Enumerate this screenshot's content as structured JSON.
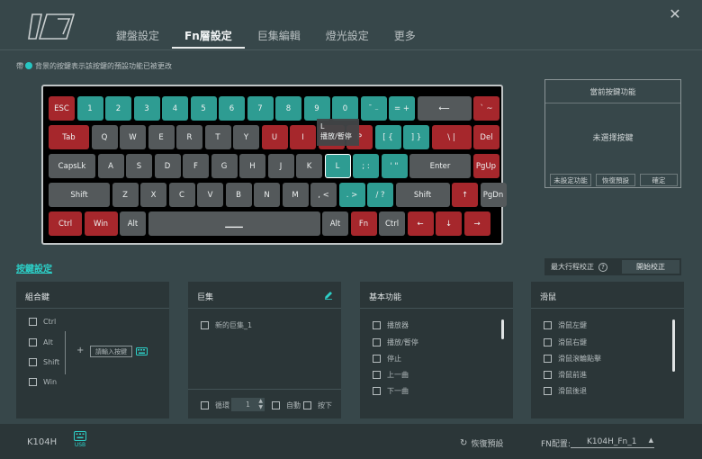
{
  "app": {
    "close_glyph": "✕"
  },
  "tabs": [
    {
      "label": "鍵盤設定"
    },
    {
      "label": "Fn層設定"
    },
    {
      "label": "巨集編輯"
    },
    {
      "label": "燈光設定"
    },
    {
      "label": "更多"
    }
  ],
  "legend": {
    "prefix": "帶",
    "text": "背景的按鍵表示該按鍵的預設功能已被更改",
    "color": "#26c6c2"
  },
  "keyboard": {
    "rows": [
      [
        {
          "label": "ESC",
          "c": "r",
          "w": 29
        },
        {
          "label": "1",
          "c": "t",
          "w": 29
        },
        {
          "label": "2",
          "c": "t",
          "w": 29
        },
        {
          "label": "3",
          "c": "t",
          "w": 29
        },
        {
          "label": "4",
          "c": "t",
          "w": 29
        },
        {
          "label": "5",
          "c": "t",
          "w": 29
        },
        {
          "label": "6",
          "c": "t",
          "w": 29
        },
        {
          "label": "7",
          "c": "t",
          "w": 29
        },
        {
          "label": "8",
          "c": "t",
          "w": 29
        },
        {
          "label": "9",
          "c": "t",
          "w": 29
        },
        {
          "label": "0",
          "c": "t",
          "w": 29
        },
        {
          "label": "¯ ₋",
          "c": "t",
          "w": 29
        },
        {
          "label": "= +",
          "c": "t",
          "w": 29
        },
        {
          "label": "⟵",
          "c": "g",
          "w": 60
        },
        {
          "label": "` ~",
          "c": "r",
          "w": 29
        }
      ],
      [
        {
          "label": "Tab",
          "c": "r",
          "w": 45
        },
        {
          "label": "Q",
          "c": "g",
          "w": 29
        },
        {
          "label": "W",
          "c": "g",
          "w": 29
        },
        {
          "label": "E",
          "c": "g",
          "w": 29
        },
        {
          "label": "R",
          "c": "g",
          "w": 29
        },
        {
          "label": "T",
          "c": "g",
          "w": 29
        },
        {
          "label": "Y",
          "c": "g",
          "w": 29
        },
        {
          "label": "U",
          "c": "r",
          "w": 29
        },
        {
          "label": "I",
          "c": "r",
          "w": 29
        },
        {
          "label": "O",
          "c": "r",
          "w": 29
        },
        {
          "label": "P",
          "c": "r",
          "w": 29
        },
        {
          "label": "[ {",
          "c": "t",
          "w": 29
        },
        {
          "label": "] }",
          "c": "t",
          "w": 29
        },
        {
          "label": "\\ |",
          "c": "r",
          "w": 44
        },
        {
          "label": "Del",
          "c": "r",
          "w": 29
        }
      ],
      [
        {
          "label": "CapsLk",
          "c": "g",
          "w": 52
        },
        {
          "label": "A",
          "c": "g",
          "w": 29
        },
        {
          "label": "S",
          "c": "g",
          "w": 29
        },
        {
          "label": "D",
          "c": "g",
          "w": 29
        },
        {
          "label": "F",
          "c": "g",
          "w": 29
        },
        {
          "label": "G",
          "c": "g",
          "w": 29
        },
        {
          "label": "H",
          "c": "g",
          "w": 29
        },
        {
          "label": "J",
          "c": "g",
          "w": 29
        },
        {
          "label": "K",
          "c": "g",
          "w": 29
        },
        {
          "label": "L",
          "c": "t",
          "w": 29,
          "sel": true
        },
        {
          "label": "; :",
          "c": "t",
          "w": 29
        },
        {
          "label": "' \"",
          "c": "t",
          "w": 29
        },
        {
          "label": "Enter",
          "c": "g",
          "w": 68
        },
        {
          "label": "PgUp",
          "c": "r",
          "w": 29
        }
      ],
      [
        {
          "label": "Shift",
          "c": "g",
          "w": 68
        },
        {
          "label": "Z",
          "c": "g",
          "w": 29
        },
        {
          "label": "X",
          "c": "g",
          "w": 29
        },
        {
          "label": "C",
          "c": "g",
          "w": 29
        },
        {
          "label": "V",
          "c": "g",
          "w": 29
        },
        {
          "label": "B",
          "c": "g",
          "w": 29
        },
        {
          "label": "N",
          "c": "g",
          "w": 29
        },
        {
          "label": "M",
          "c": "g",
          "w": 29
        },
        {
          "label": ", <",
          "c": "g",
          "w": 29
        },
        {
          "label": ". >",
          "c": "t",
          "w": 29
        },
        {
          "label": "/ ?",
          "c": "t",
          "w": 29
        },
        {
          "label": "Shift",
          "c": "g",
          "w": 60
        },
        {
          "label": "↑",
          "c": "r",
          "w": 29
        },
        {
          "label": "PgDn",
          "c": "g",
          "w": 29
        }
      ],
      [
        {
          "label": "Ctrl",
          "c": "r",
          "w": 37
        },
        {
          "label": "Win",
          "c": "r",
          "w": 37
        },
        {
          "label": "Alt",
          "c": "g",
          "w": 29
        },
        {
          "label": "▁▁▁",
          "c": "g",
          "w": 191
        },
        {
          "label": "Alt",
          "c": "g",
          "w": 29
        },
        {
          "label": "Fn",
          "c": "r",
          "w": 29
        },
        {
          "label": "Ctrl",
          "c": "g",
          "w": 29
        },
        {
          "label": "←",
          "c": "r",
          "w": 29
        },
        {
          "label": "↓",
          "c": "r",
          "w": 29
        },
        {
          "label": "→",
          "c": "r",
          "w": 29
        }
      ]
    ]
  },
  "tooltip": {
    "key": "L",
    "action": "播放/暫停"
  },
  "current_panel": {
    "title": "當前按鍵功能",
    "message": "未選擇按鍵",
    "buttons": [
      "未設定功能",
      "恢復預設",
      "確定"
    ]
  },
  "key_settings": {
    "header": "按鍵設定"
  },
  "travel": {
    "label": "最大行程校正",
    "help": "?",
    "button": "開始校正"
  },
  "combo": {
    "title": "組合鍵",
    "items": [
      "Ctrl",
      "Alt",
      "Shift",
      "Win"
    ],
    "plus": "+",
    "input_placeholder": "請輸入按鍵"
  },
  "macro": {
    "title": "巨集",
    "items": [
      "新的巨集_1"
    ],
    "loop_label": "循環",
    "loop_value": "1",
    "auto_label": "自動",
    "press_label": "按下"
  },
  "basic": {
    "title": "基本功能",
    "items": [
      "播放器",
      "播放/暫停",
      "停止",
      "上一曲",
      "下一曲"
    ]
  },
  "mouse": {
    "title": "滑鼠",
    "items": [
      "滑鼠左鍵",
      "滑鼠右鍵",
      "滑鼠滾輪點擊",
      "滑鼠前進",
      "滑鼠後退"
    ]
  },
  "footer": {
    "model": "K104H",
    "usb": "USB",
    "restore": "恢復預設",
    "fn_label": "FN配置:",
    "fn_value": "K104H_Fn_1"
  }
}
